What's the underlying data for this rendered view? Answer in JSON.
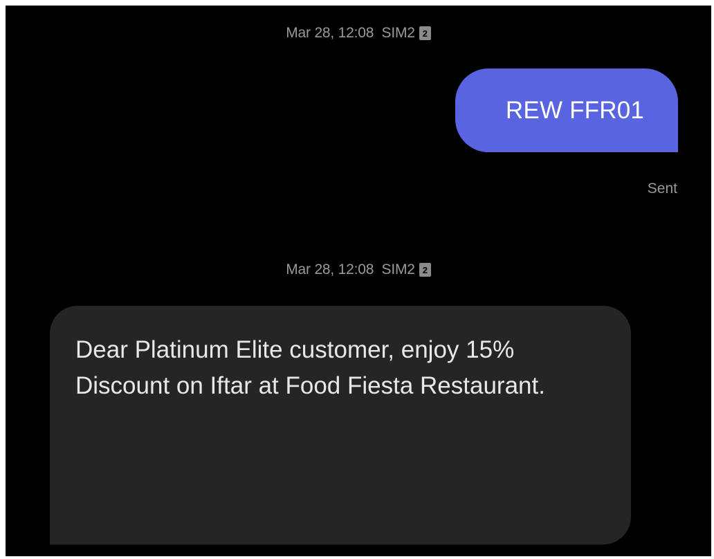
{
  "thread": {
    "messages": [
      {
        "timestamp": "Mar 28, 12:08",
        "sim": "SIM2",
        "sim_badge": "2",
        "direction": "sent",
        "text": "REW FFR01",
        "status": "Sent",
        "bubble_color": "#5864e0"
      },
      {
        "timestamp": "Mar 28, 12:08",
        "sim": "SIM2",
        "sim_badge": "2",
        "direction": "received",
        "text": "Dear Platinum Elite customer, enjoy 15% Discount on Iftar at Food Fiesta Restaurant.",
        "bubble_color": "#252525"
      }
    ]
  },
  "icons": {
    "sim_badge": "sim-card-2-icon"
  },
  "colors": {
    "background": "#000000",
    "meta_text": "#9a9a9a"
  }
}
